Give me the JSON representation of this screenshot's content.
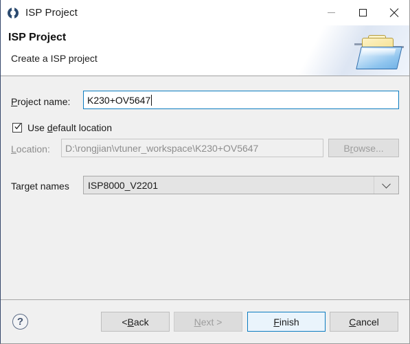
{
  "window": {
    "title": "ISP Project",
    "icon": "isp-app-icon",
    "controls": {
      "minimize": "minimize-icon",
      "maximize": "maximize-icon",
      "close": "close-icon"
    }
  },
  "header": {
    "title": "ISP Project",
    "subtitle": "Create a ISP project",
    "icon": "open-folder-icon"
  },
  "form": {
    "project_name": {
      "label_before": "P",
      "label_mnemonic": "P",
      "label": "Project name:",
      "label_pre": "",
      "label_post": "roject name:",
      "value": "K230+OV5647",
      "placeholder": ""
    },
    "use_default_location": {
      "label_pre": "Use ",
      "label_mnemonic": "d",
      "label_post": "efault location",
      "checked": true,
      "check_glyph": "check-icon"
    },
    "location": {
      "label_mnemonic": "L",
      "label_post": "ocation:",
      "value": "D:\\rongjian\\vtuner_workspace\\K230+OV5647",
      "enabled": false
    },
    "browse": {
      "label_pre": "B",
      "label_mnemonic": "r",
      "label_post": "owse...",
      "enabled": false
    },
    "target_names": {
      "label": "Target names",
      "value": "ISP8000_V2201",
      "arrow": "chevron-down-icon",
      "options": [
        "ISP8000_V2201"
      ]
    }
  },
  "footer": {
    "help": "?",
    "help_icon": "help-icon",
    "back": {
      "label_pre": "< ",
      "label_mnemonic": "B",
      "label_post": "ack",
      "enabled": true
    },
    "next": {
      "label_pre": "",
      "label_mnemonic": "N",
      "label_post": "ext >",
      "enabled": false
    },
    "finish": {
      "label_pre": "",
      "label_mnemonic": "F",
      "label_post": "inish",
      "enabled": true,
      "is_default": true
    },
    "cancel": {
      "label_pre": "",
      "label_mnemonic": "C",
      "label_post": "ancel",
      "enabled": true
    }
  },
  "colors": {
    "accent": "#0a7bc0",
    "body_bg": "#f0f0f0",
    "header_bg": "#ffffff",
    "disabled_text": "#8d8d8d"
  }
}
